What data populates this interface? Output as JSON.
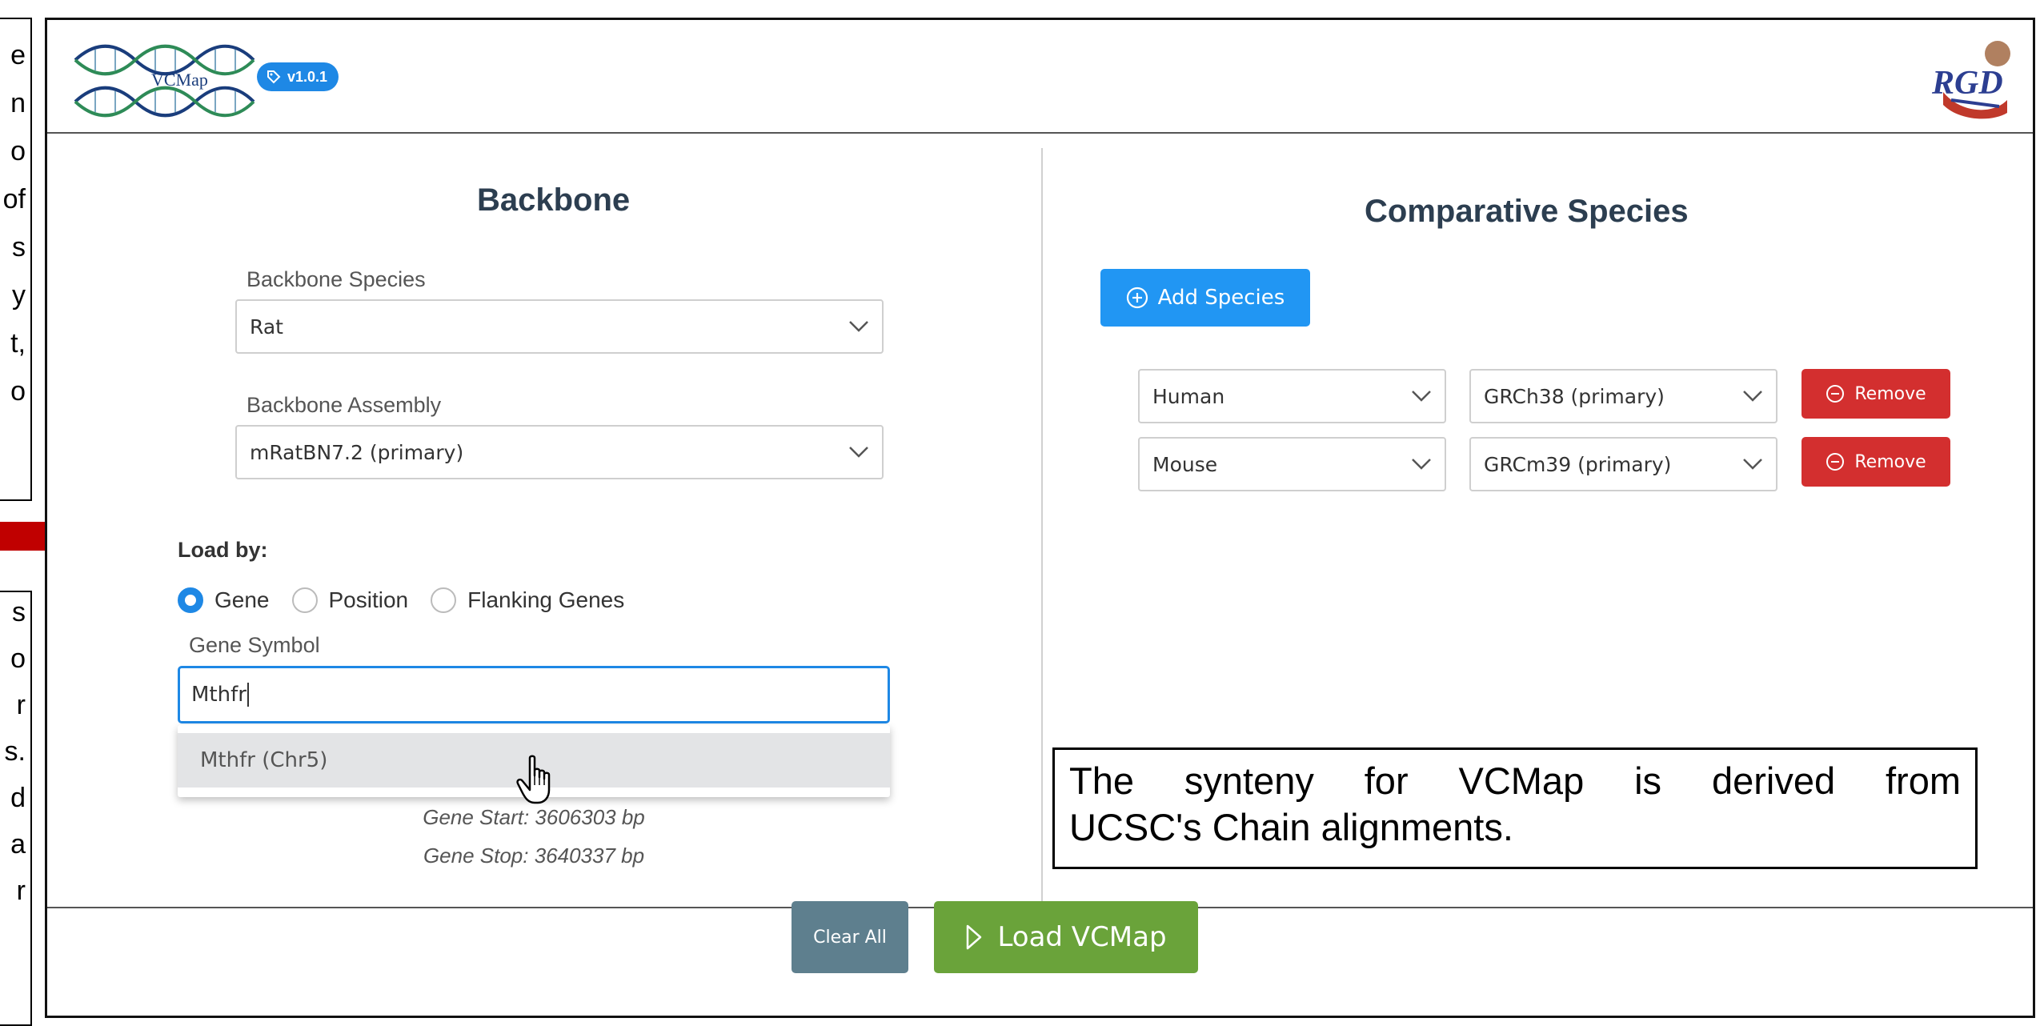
{
  "annotations": {
    "left_top_chars": [
      "e",
      "n",
      "o",
      "of",
      "s",
      "y",
      "t,",
      "o"
    ],
    "left_bottom_chars": [
      "s",
      "o",
      "r",
      "s.",
      "d",
      "a",
      "r"
    ],
    "synteny_note_line1": "The synteny for VCMap is derived from",
    "synteny_note_line2": "UCSC's Chain alignments."
  },
  "header": {
    "app_logo_text": "VCMap",
    "version": "v1.0.1",
    "institute_logo": "RGD"
  },
  "backbone": {
    "title": "Backbone",
    "species_label": "Backbone Species",
    "species_value": "Rat",
    "assembly_label": "Backbone Assembly",
    "assembly_value": "mRatBN7.2 (primary)",
    "load_by_label": "Load by:",
    "load_options": [
      "Gene",
      "Position",
      "Flanking Genes"
    ],
    "selected_option": "Gene",
    "gene_symbol_label": "Gene Symbol",
    "gene_symbol_value": "Mthfr",
    "suggestion": "Mthfr (Chr5)",
    "gene_start": "Gene Start: 3606303 bp",
    "gene_stop": "Gene Stop: 3640337 bp"
  },
  "comparative": {
    "title": "Comparative Species",
    "add_label": "Add Species",
    "rows": [
      {
        "species": "Human",
        "assembly": "GRCh38 (primary)",
        "remove_label": "Remove"
      },
      {
        "species": "Mouse",
        "assembly": "GRCm39 (primary)",
        "remove_label": "Remove"
      }
    ]
  },
  "footer": {
    "clear_label": "Clear All",
    "load_label": "Load VCMap"
  },
  "colors": {
    "primary": "#1e88e5",
    "add_button": "#2196f3",
    "remove_button": "#d32f2f",
    "clear_button": "#5e7f8e",
    "load_button": "#6aa33a",
    "arrow": "#c00000"
  }
}
